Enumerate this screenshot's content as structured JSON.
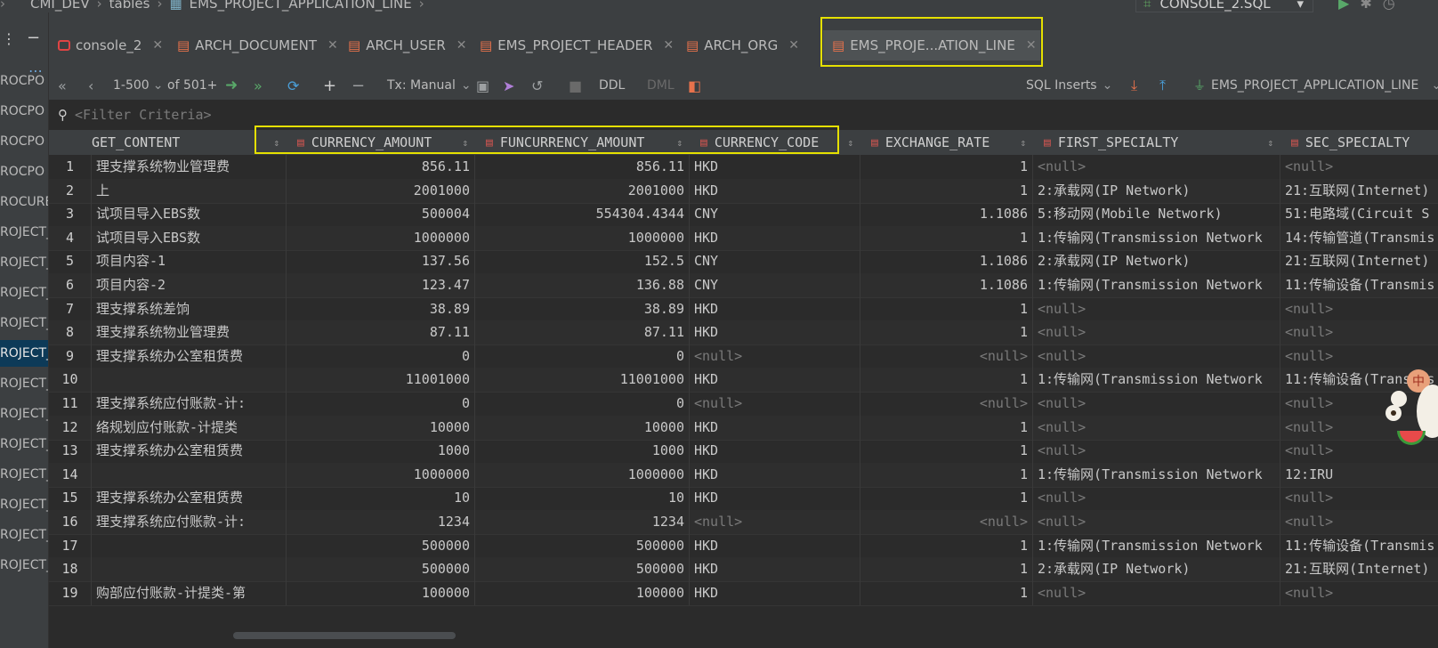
{
  "breadcrumb": {
    "project": "CMI_DEV",
    "folder": "tables",
    "table": "EMS_PROJECT_APPLICATION_LINE"
  },
  "console_select": {
    "label": "CONSOLE_2.SQL"
  },
  "left_strip": {
    "items": [
      "ROCPO",
      "ROCPO",
      "ROCPO",
      "ROCPO",
      "ROCURE",
      "ROJECT_",
      "ROJECT_",
      "ROJECT_",
      "ROJECT_",
      "ROJECT_",
      "ROJECT_",
      "ROJECT_",
      "ROJECT_",
      "ROJECT_",
      "ROJECT_",
      "ROJECT_",
      "ROJECT_"
    ],
    "selected_index": 9
  },
  "tabs": [
    {
      "label": "console_2",
      "icon": "console-icon"
    },
    {
      "label": "ARCH_DOCUMENT",
      "icon": "table-icon"
    },
    {
      "label": "ARCH_USER",
      "icon": "table-icon"
    },
    {
      "label": "EMS_PROJECT_HEADER",
      "icon": "table-icon"
    },
    {
      "label": "ARCH_ORG",
      "icon": "table-icon"
    },
    {
      "label": "EMS_PROJE...ATION_LINE",
      "icon": "table-icon",
      "active": true
    }
  ],
  "toolbar": {
    "page_range": "1-500",
    "total": "of 501+",
    "tx_mode": "Tx: Manual",
    "ddl": "DDL",
    "dml": "DML",
    "export_format": "SQL Inserts",
    "datasource": "EMS_PROJECT_APPLICATION_LINE"
  },
  "filter": {
    "placeholder": "<Filter Criteria>"
  },
  "grid": {
    "columns": [
      "GET_CONTENT",
      "CURRENCY_AMOUNT",
      "FUNCURRENCY_AMOUNT",
      "CURRENCY_CODE",
      "EXCHANGE_RATE",
      "FIRST_SPECIALTY",
      "SEC_SPECIALTY"
    ],
    "rows": [
      {
        "n": "1",
        "c0": "理支撑系统物业管理费",
        "c1": "856.11",
        "c2": "856.11",
        "c3": "HKD",
        "c4": "1",
        "c5": "<null>",
        "c6": "<null>"
      },
      {
        "n": "2",
        "c0": "上",
        "c1": "2001000",
        "c2": "2001000",
        "c3": "HKD",
        "c4": "1",
        "c5": "2:承载网(IP Network)",
        "c6": "21:互联网(Internet)"
      },
      {
        "n": "3",
        "c0": "试项目导入EBS数",
        "c1": "500004",
        "c2": "554304.4344",
        "c3": "CNY",
        "c4": "1.1086",
        "c5": "5:移动网(Mobile Network)",
        "c6": "51:电路域(Circuit S"
      },
      {
        "n": "4",
        "c0": "试项目导入EBS数",
        "c1": "1000000",
        "c2": "1000000",
        "c3": "HKD",
        "c4": "1",
        "c5": "1:传输网(Transmission Network",
        "c6": "14:传输管道(Transmis"
      },
      {
        "n": "5",
        "c0": "项目内容-1",
        "c1": "137.56",
        "c2": "152.5",
        "c3": "CNY",
        "c4": "1.1086",
        "c5": "2:承载网(IP Network)",
        "c6": "21:互联网(Internet)"
      },
      {
        "n": "6",
        "c0": "项目内容-2",
        "c1": "123.47",
        "c2": "136.88",
        "c3": "CNY",
        "c4": "1.1086",
        "c5": "1:传输网(Transmission Network",
        "c6": "11:传输设备(Transmis"
      },
      {
        "n": "7",
        "c0": "理支撑系统差饷",
        "c1": "38.89",
        "c2": "38.89",
        "c3": "HKD",
        "c4": "1",
        "c5": "<null>",
        "c6": "<null>"
      },
      {
        "n": "8",
        "c0": "理支撑系统物业管理费",
        "c1": "87.11",
        "c2": "87.11",
        "c3": "HKD",
        "c4": "1",
        "c5": "<null>",
        "c6": "<null>"
      },
      {
        "n": "9",
        "c0": "理支撑系统办公室租赁费",
        "c1": "0",
        "c2": "0",
        "c3": "<null>",
        "c4": "<null>",
        "c5": "<null>",
        "c6": "<null>"
      },
      {
        "n": "10",
        "c0": "",
        "c1": "11001000",
        "c2": "11001000",
        "c3": "HKD",
        "c4": "1",
        "c5": "1:传输网(Transmission Network",
        "c6": "11:传输设备(Transmis"
      },
      {
        "n": "11",
        "c0": "理支撑系统应付账款-计:",
        "c1": "0",
        "c2": "0",
        "c3": "<null>",
        "c4": "<null>",
        "c5": "<null>",
        "c6": "<null>"
      },
      {
        "n": "12",
        "c0": "络规划应付账款-计提类",
        "c1": "10000",
        "c2": "10000",
        "c3": "HKD",
        "c4": "1",
        "c5": "<null>",
        "c6": "<null>"
      },
      {
        "n": "13",
        "c0": "理支撑系统办公室租赁费",
        "c1": "1000",
        "c2": "1000",
        "c3": "HKD",
        "c4": "1",
        "c5": "<null>",
        "c6": "<null>"
      },
      {
        "n": "14",
        "c0": "",
        "c1": "1000000",
        "c2": "1000000",
        "c3": "HKD",
        "c4": "1",
        "c5": "1:传输网(Transmission Network",
        "c6": "12:IRU"
      },
      {
        "n": "15",
        "c0": "理支撑系统办公室租赁费",
        "c1": "10",
        "c2": "10",
        "c3": "HKD",
        "c4": "1",
        "c5": "<null>",
        "c6": "<null>"
      },
      {
        "n": "16",
        "c0": "理支撑系统应付账款-计:",
        "c1": "1234",
        "c2": "1234",
        "c3": "<null>",
        "c4": "<null>",
        "c5": "<null>",
        "c6": "<null>"
      },
      {
        "n": "17",
        "c0": "",
        "c1": "500000",
        "c2": "500000",
        "c3": "HKD",
        "c4": "1",
        "c5": "1:传输网(Transmission Network",
        "c6": "11:传输设备(Transmis"
      },
      {
        "n": "18",
        "c0": "",
        "c1": "500000",
        "c2": "500000",
        "c3": "HKD",
        "c4": "1",
        "c5": "2:承载网(IP Network)",
        "c6": "21:互联网(Internet)"
      },
      {
        "n": "19",
        "c0": "购部应付账款-计提类-第",
        "c1": "100000",
        "c2": "100000",
        "c3": "HKD",
        "c4": "1",
        "c5": "<null>",
        "c6": "<null>"
      }
    ]
  },
  "colors": {
    "highlight": "#e5e000",
    "null_text": "#7a7a7a",
    "table_icon": "#e8724c",
    "column_icon": "#c75450"
  }
}
